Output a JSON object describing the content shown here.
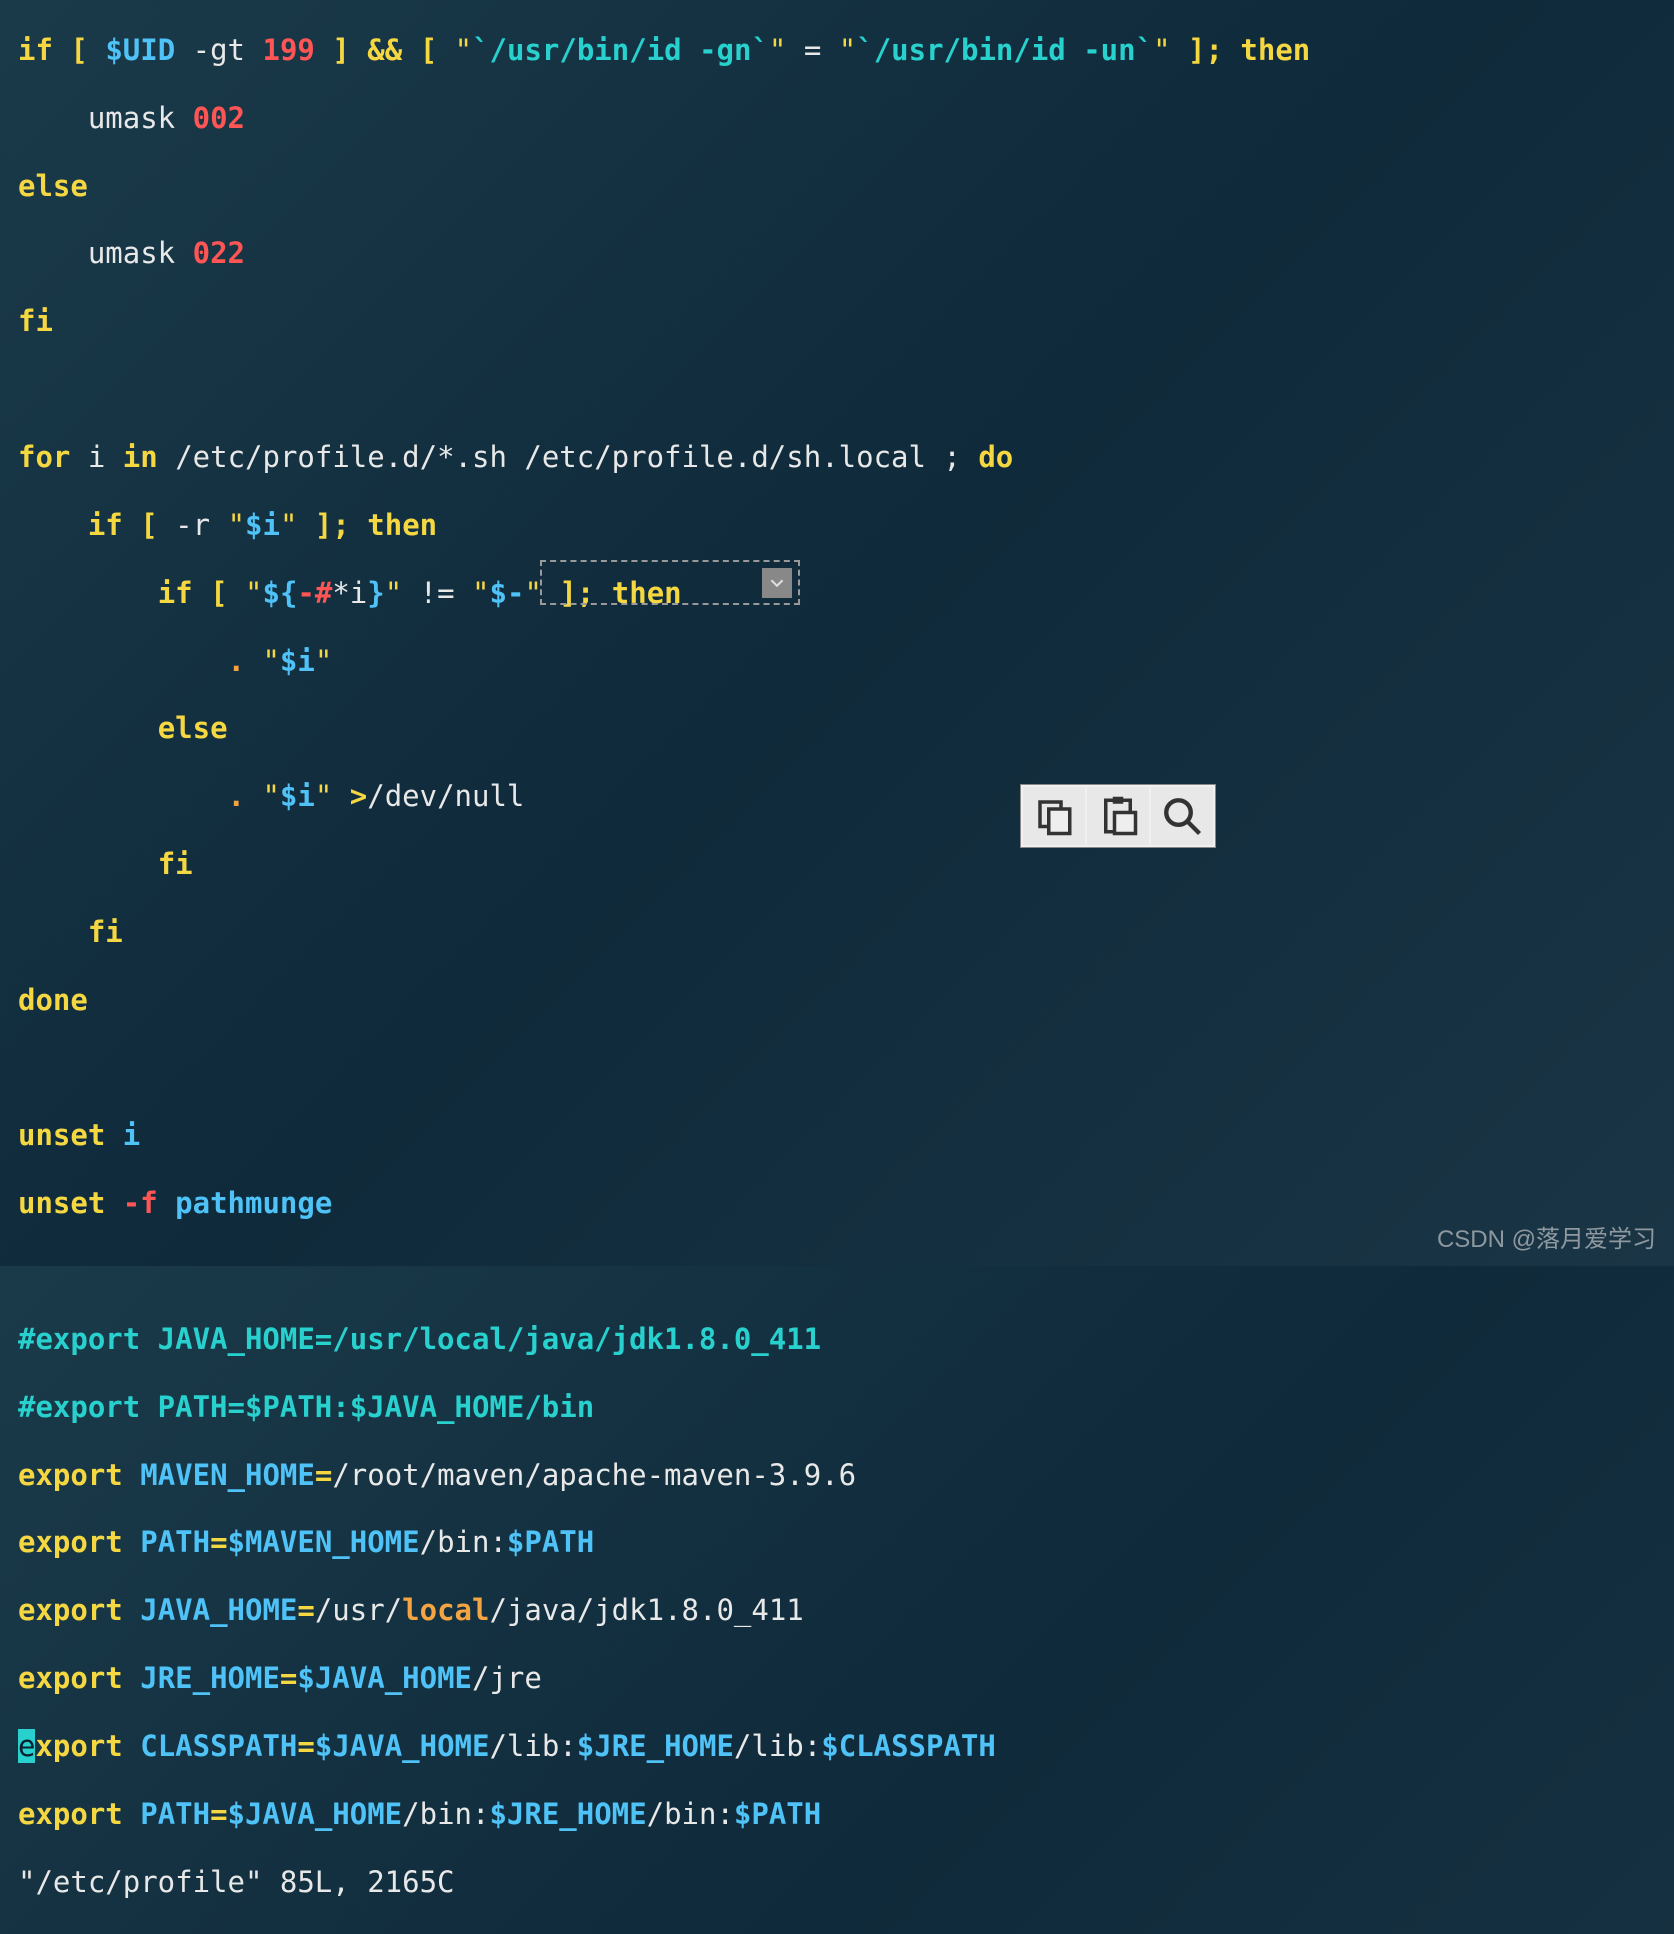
{
  "code": {
    "l1": {
      "a": "if",
      "b": "[",
      "c": "$UID",
      "d": "-gt",
      "e": "199",
      "f": "]",
      "g": "&&",
      "h": "[",
      "i": "\"",
      "j": "`/usr/bin/id -gn`",
      "k": "\"",
      "l": "=",
      "m": "\"",
      "n": "`/usr/bin/id -un`",
      "o": "\"",
      "p": "]",
      "q": ";",
      "r": "then"
    },
    "l2": {
      "a": "umask",
      "b": "002"
    },
    "l3": {
      "a": "else"
    },
    "l4": {
      "a": "umask",
      "b": "022"
    },
    "l5": {
      "a": "fi"
    },
    "l6": {
      "a": "for",
      "b": "i",
      "c": "in",
      "d": "/etc/profile.d/*.sh /etc/profile.d/sh.local ;",
      "e": "do"
    },
    "l7": {
      "a": "if",
      "b": "[",
      "c": "-r",
      "d": "\"",
      "e": "$i",
      "f": "\"",
      "g": "]",
      "h": ";",
      "i": "then"
    },
    "l8": {
      "a": "if",
      "b": "[",
      "c": "\"",
      "d": "${",
      "e": "-#",
      "f": "*i",
      "g": "}",
      "h": "\"",
      "i": "!=",
      "j": "\"",
      "k": "$-",
      "l": "\"",
      "m": "]",
      "n": ";",
      "o": "then"
    },
    "l9": {
      "a": ".",
      "b": "\"",
      "c": "$i",
      "d": "\""
    },
    "l10": {
      "a": "else"
    },
    "l11": {
      "a": ".",
      "b": "\"",
      "c": "$i",
      "d": "\"",
      "e": ">",
      "f": "/dev/null"
    },
    "l12": {
      "a": "fi"
    },
    "l13": {
      "a": "fi"
    },
    "l14": {
      "a": "done"
    },
    "l15": {
      "a": "unset",
      "b": "i"
    },
    "l16": {
      "a": "unset",
      "b": "-f",
      "c": "pathmunge"
    },
    "l17": {
      "a": "#export JAVA_HOME=/usr/local/java/jdk1.8.0_411"
    },
    "l18": {
      "a": "#export PATH=$PATH:$JAVA_HOME/bin"
    },
    "l19": {
      "a": "export",
      "b": "MAVEN_HOME",
      "c": "=",
      "d": "/root/maven/apache-maven-3.9.6"
    },
    "l20": {
      "a": "export",
      "b": "PATH",
      "c": "=",
      "d": "$MAVEN_HOME",
      "e": "/bin:",
      "f": "$PATH"
    },
    "l21": {
      "a": "export",
      "b": "JAVA_HOME",
      "c": "=",
      "d": "/usr/",
      "e": "local",
      "f": "/java/jdk1.8.0_411"
    },
    "l22": {
      "a": "export",
      "b": "JRE_HOME",
      "c": "=",
      "d": "$JAVA_HOME",
      "e": "/jre"
    },
    "l23": {
      "cur": "e",
      "a": "xport",
      "b": "CLASSPATH",
      "c": "=",
      "d": "$JAVA_HOME",
      "e": "/lib:",
      "f": "$JRE_HOME",
      "g": "/lib:",
      "h": "$CLASSPATH"
    },
    "l24": {
      "a": "export",
      "b": "PATH",
      "c": "=",
      "d": "$JAVA_HOME",
      "e": "/bin:",
      "f": "$JRE_HOME",
      "g": "/bin:",
      "h": "$PATH"
    }
  },
  "status": "\"/etc/profile\" 85L, 2165C",
  "watermark": "CSDN @落月爱学习",
  "icons": {
    "dropdown": "▾",
    "copy": "copy-icon",
    "paste": "paste-icon",
    "search": "search-icon"
  }
}
